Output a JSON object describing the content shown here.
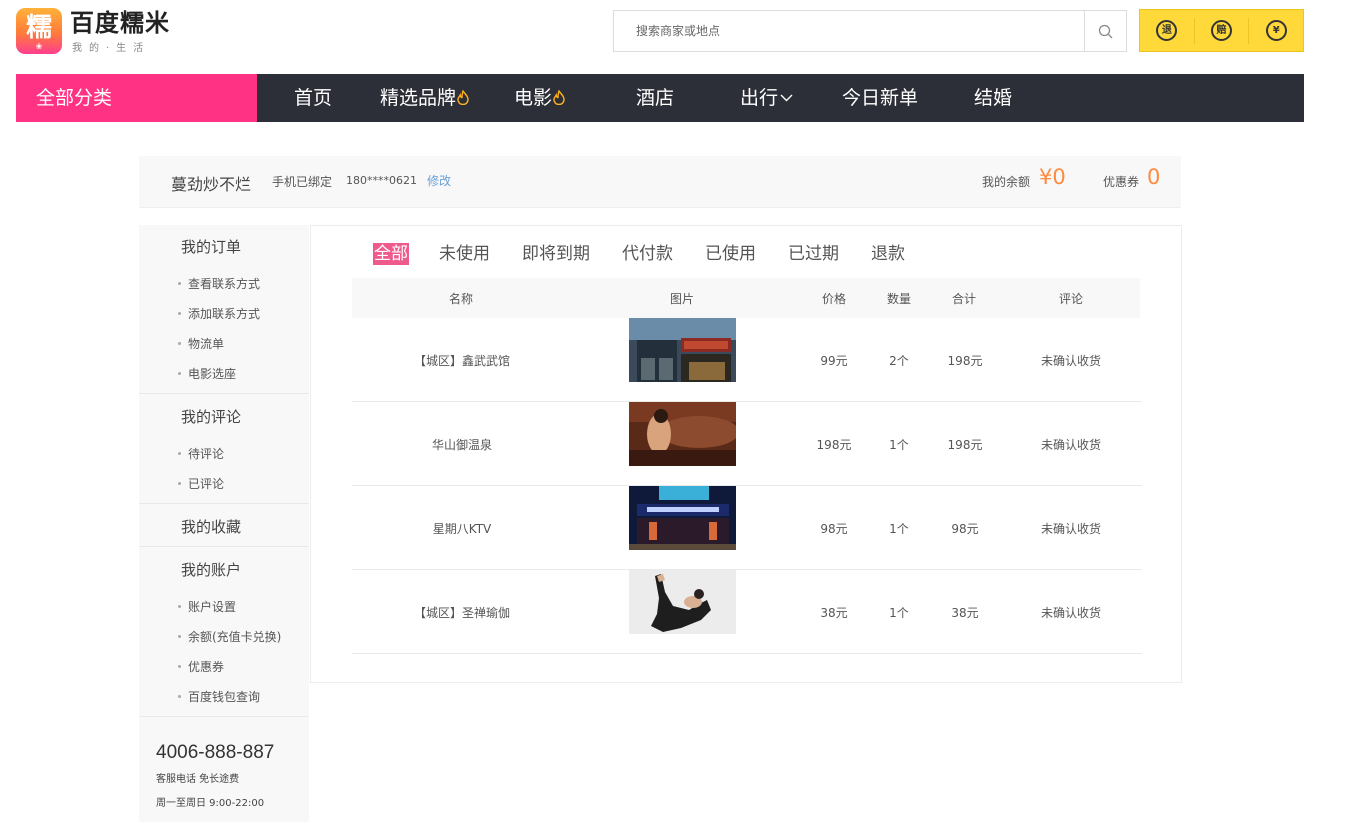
{
  "brand": {
    "logo_char": "糯",
    "logo_sub": "❀",
    "name": "百度糯米",
    "slogan": "我的·生活"
  },
  "search": {
    "placeholder": "搜索商家或地点"
  },
  "guarantees": [
    "退",
    "赔",
    "¥"
  ],
  "nav": {
    "all_categories": "全部分类",
    "items": [
      "首页",
      "精选品牌",
      "电影",
      "酒店",
      "出行",
      "今日新单",
      "结婚"
    ]
  },
  "user": {
    "name": "蔓劲炒不烂",
    "phone_label": "手机已绑定",
    "phone": "180****0621",
    "edit": "修改",
    "balance_label": "我的余额",
    "balance": "¥0",
    "coupon_label": "优惠券",
    "coupon": "0"
  },
  "sidebar": {
    "orders": {
      "title": "我的订单",
      "items": [
        "查看联系方式",
        "添加联系方式",
        "物流单",
        "电影选座"
      ]
    },
    "reviews": {
      "title": "我的评论",
      "items": [
        "待评论",
        "已评论"
      ]
    },
    "favorites": {
      "title": "我的收藏"
    },
    "account": {
      "title": "我的账户",
      "items": [
        "账户设置",
        "余额(充值卡兑换)",
        "优惠券",
        "百度钱包查询"
      ]
    },
    "hotline": "4006-888-887",
    "hotline_note": "客服电话 免长途费",
    "hours": "周一至周日 9:00-22:00"
  },
  "tabs": [
    "全部",
    "未使用",
    "即将到期",
    "代付款",
    "已使用",
    "已过期",
    "退款"
  ],
  "table": {
    "headers": [
      "名称",
      "图片",
      "价格",
      "数量",
      "合计",
      "评论"
    ],
    "rows": [
      {
        "name": "【城区】鑫武武馆",
        "price": "99元",
        "qty": "2个",
        "total": "198元",
        "status": "未确认收货"
      },
      {
        "name": "华山御温泉",
        "price": "198元",
        "qty": "1个",
        "total": "198元",
        "status": "未确认收货"
      },
      {
        "name": "星期八KTV",
        "price": "98元",
        "qty": "1个",
        "total": "98元",
        "status": "未确认收货"
      },
      {
        "name": "【城区】圣禅瑜伽",
        "price": "38元",
        "qty": "1个",
        "total": "38元",
        "status": "未确认收货"
      }
    ]
  },
  "colors": {
    "accent_pink": "#ff3283",
    "nav_dark": "#2d2f38",
    "money_orange": "#ff8a3d",
    "badge_yellow": "#ffd93a",
    "link_blue": "#6aa1d8"
  }
}
